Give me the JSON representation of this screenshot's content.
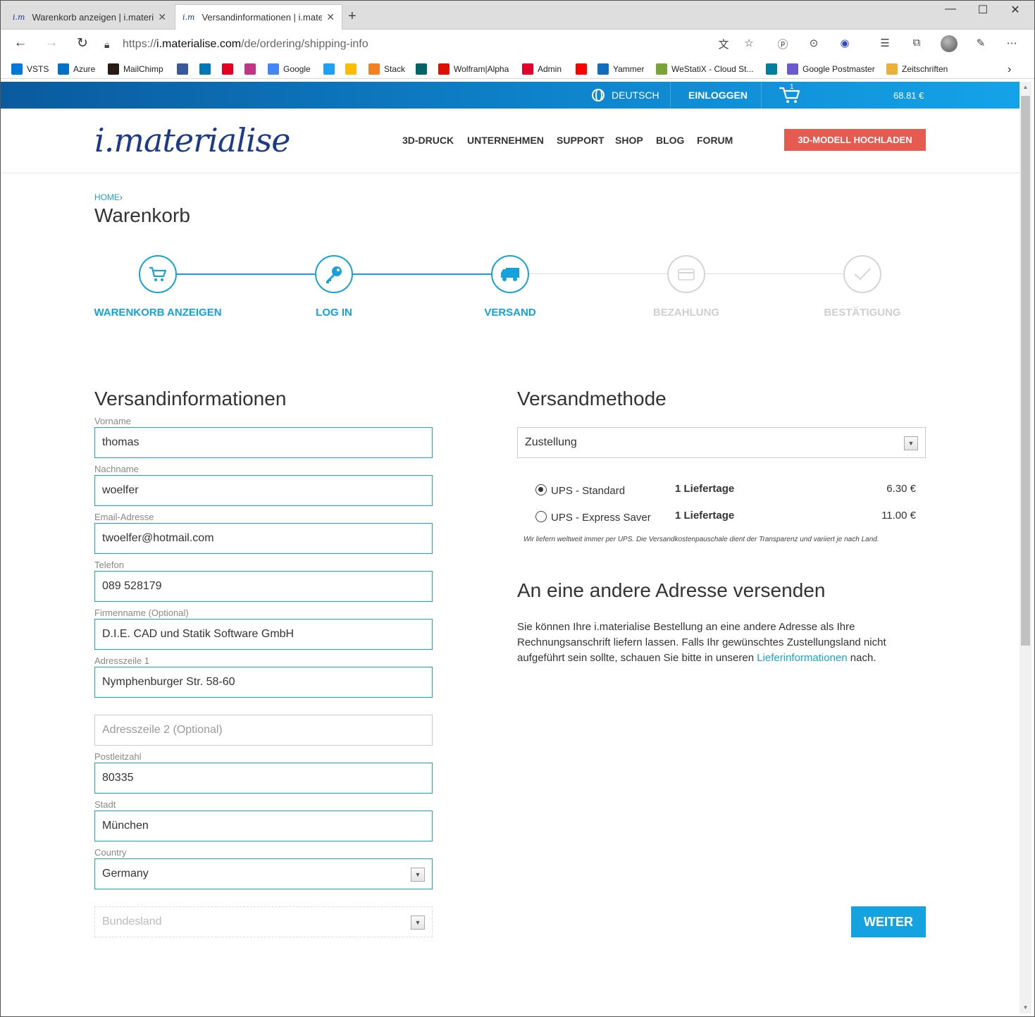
{
  "browser": {
    "tabs": [
      {
        "title": "Warenkorb anzeigen | i.materialise",
        "favicon": "i.m"
      },
      {
        "title": "Versandinformationen | i.materialise",
        "favicon": "i.m"
      }
    ],
    "url": {
      "protocol": "https://",
      "host": "i.materialise.com",
      "path": "/de/ordering/shipping-info"
    },
    "bookmarks": [
      {
        "label": "VSTS",
        "color": "#0078d7"
      },
      {
        "label": "Azure",
        "color": "#0072c6"
      },
      {
        "label": "MailChimp",
        "color": "#241c15"
      },
      {
        "label": "",
        "color": "#3b5998"
      },
      {
        "label": "",
        "color": "#0077b5"
      },
      {
        "label": "",
        "color": "#e60023"
      },
      {
        "label": "",
        "color": "#c13584"
      },
      {
        "label": "Google",
        "color": "#4285f4"
      },
      {
        "label": "",
        "color": "#1da1f2"
      },
      {
        "label": "",
        "color": "#fbbc04"
      },
      {
        "label": "Stack",
        "color": "#f48024"
      },
      {
        "label": "",
        "color": "#026466"
      },
      {
        "label": "Wolfram|Alpha",
        "color": "#dd1100"
      },
      {
        "label": "Admin",
        "color": "#e4002b"
      },
      {
        "label": "",
        "color": "#ff0000"
      },
      {
        "label": "Yammer",
        "color": "#106ebe"
      },
      {
        "label": "WeStatiX - Cloud St...",
        "color": "#7aa33a"
      },
      {
        "label": "",
        "color": "#00809d"
      },
      {
        "label": "Google Postmaster",
        "color": "#6a5acd"
      },
      {
        "label": "Zeitschriften",
        "color": "#e8b23a"
      }
    ]
  },
  "topstrip": {
    "language": "DEUTSCH",
    "login": "EINLOGGEN",
    "cart_count": "1",
    "cart_total": "68.81 €"
  },
  "header": {
    "logo": "i.materialise",
    "nav": [
      "3D-DRUCK",
      "UNTERNEHMEN",
      "SUPPORT",
      "SHOP",
      "BLOG",
      "FORUM"
    ],
    "upload_button": "3D-MODELL HOCHLADEN"
  },
  "breadcrumb": {
    "home": "HOME",
    "separator": "›"
  },
  "page_title": "Warenkorb",
  "steps": [
    {
      "label": "WARENKORB ANZEIGEN",
      "icon": "cart-icon",
      "state": "done"
    },
    {
      "label": "LOG IN",
      "icon": "key-icon",
      "state": "done"
    },
    {
      "label": "VERSAND",
      "icon": "truck-icon",
      "state": "done"
    },
    {
      "label": "BEZAHLUNG",
      "icon": "credit-card-icon",
      "state": "todo"
    },
    {
      "label": "BESTÄTIGUNG",
      "icon": "checkmark-icon",
      "state": "todo"
    }
  ],
  "shipping_info": {
    "title": "Versandinformationen",
    "fields": {
      "vorname": {
        "label": "Vorname",
        "value": "thomas"
      },
      "nachname": {
        "label": "Nachname",
        "value": "woelfer"
      },
      "email": {
        "label": "Email-Adresse",
        "value": "twoelfer@hotmail.com"
      },
      "telefon": {
        "label": "Telefon",
        "value": "089 528179"
      },
      "firma": {
        "label": "Firmenname (Optional)",
        "value": "D.I.E. CAD und Statik Software GmbH"
      },
      "adresse1": {
        "label": "Adresszeile 1",
        "value": "Nymphenburger Str. 58-60"
      },
      "adresse2": {
        "placeholder": "Adresszeile 2 (Optional)"
      },
      "plz": {
        "label": "Postleitzahl",
        "value": "80335"
      },
      "stadt": {
        "label": "Stadt",
        "value": "München"
      },
      "country": {
        "label": "Country",
        "value": "Germany"
      },
      "bundesland": {
        "placeholder": "Bundesland"
      }
    }
  },
  "shipping_method": {
    "title": "Versandmethode",
    "select_value": "Zustellung",
    "options": [
      {
        "name": "UPS - Standard",
        "days": "1 Liefertage",
        "price": "6.30 €",
        "selected": true
      },
      {
        "name": "UPS - Express Saver",
        "days": "1 Liefertage",
        "price": "11.00 €",
        "selected": false
      }
    ],
    "note": "Wir liefern weltweit immer per UPS. Die Versandkostenpauschale dient der Transparenz und variiert je nach Land."
  },
  "alt_address": {
    "title": "An eine andere Adresse versenden",
    "text_before": "Sie können Ihre i.materialise Bestellung an eine andere Adresse als Ihre Rechnungsanschrift liefern lassen. Falls Ihr gewünschtes Zustellungsland nicht aufgeführt sein sollte, schauen Sie bitte in unseren ",
    "link": "Lieferinformationen",
    "text_after": " nach."
  },
  "continue_button": "WEITER",
  "colors": {
    "accent": "#14a3e0",
    "brand": "#1b3a8a",
    "upload": "#e65a4f",
    "inactive": "#d5d5d5"
  }
}
